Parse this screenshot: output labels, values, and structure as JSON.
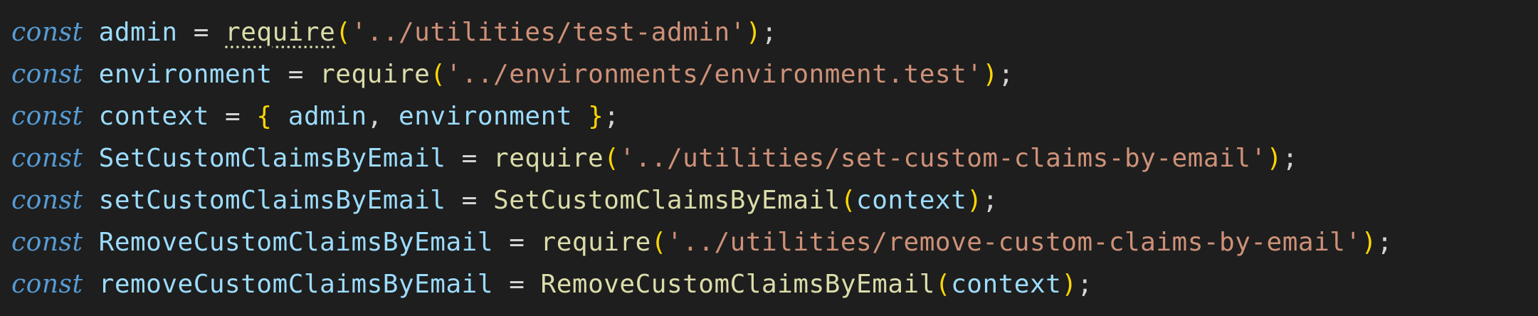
{
  "colors": {
    "background": "#1e1e1e",
    "keyword": "#569cd6",
    "identifier": "#9cdcfe",
    "operator": "#d4d4d4",
    "function": "#dcdcaa",
    "bracket": "#ffd700",
    "string": "#ce9178",
    "punctuation": "#d4d4d4"
  },
  "code": {
    "lines": [
      [
        {
          "text": "const",
          "kind": "keyword"
        },
        {
          "text": " ",
          "kind": "space"
        },
        {
          "text": "admin",
          "kind": "identifier"
        },
        {
          "text": " = ",
          "kind": "operator"
        },
        {
          "text": "require",
          "kind": "function",
          "decoration": "dotted"
        },
        {
          "text": "(",
          "kind": "bracket"
        },
        {
          "text": "'../utilities/test-admin'",
          "kind": "string"
        },
        {
          "text": ")",
          "kind": "bracket"
        },
        {
          "text": ";",
          "kind": "punctuation"
        }
      ],
      [
        {
          "text": "const",
          "kind": "keyword"
        },
        {
          "text": " ",
          "kind": "space"
        },
        {
          "text": "environment",
          "kind": "identifier"
        },
        {
          "text": " = ",
          "kind": "operator"
        },
        {
          "text": "require",
          "kind": "function"
        },
        {
          "text": "(",
          "kind": "bracket"
        },
        {
          "text": "'../environments/environment.test'",
          "kind": "string"
        },
        {
          "text": ")",
          "kind": "bracket"
        },
        {
          "text": ";",
          "kind": "punctuation"
        }
      ],
      [
        {
          "text": "const",
          "kind": "keyword"
        },
        {
          "text": " ",
          "kind": "space"
        },
        {
          "text": "context",
          "kind": "identifier"
        },
        {
          "text": " = ",
          "kind": "operator"
        },
        {
          "text": "{",
          "kind": "bracket"
        },
        {
          "text": " ",
          "kind": "space"
        },
        {
          "text": "admin",
          "kind": "identifier"
        },
        {
          "text": ", ",
          "kind": "punctuation"
        },
        {
          "text": "environment",
          "kind": "identifier"
        },
        {
          "text": " ",
          "kind": "space"
        },
        {
          "text": "}",
          "kind": "bracket"
        },
        {
          "text": ";",
          "kind": "punctuation"
        }
      ],
      [
        {
          "text": "const",
          "kind": "keyword"
        },
        {
          "text": " ",
          "kind": "space"
        },
        {
          "text": "SetCustomClaimsByEmail",
          "kind": "identifier"
        },
        {
          "text": " = ",
          "kind": "operator"
        },
        {
          "text": "require",
          "kind": "function"
        },
        {
          "text": "(",
          "kind": "bracket"
        },
        {
          "text": "'../utilities/set-custom-claims-by-email'",
          "kind": "string"
        },
        {
          "text": ")",
          "kind": "bracket"
        },
        {
          "text": ";",
          "kind": "punctuation"
        }
      ],
      [
        {
          "text": "const",
          "kind": "keyword"
        },
        {
          "text": " ",
          "kind": "space"
        },
        {
          "text": "setCustomClaimsByEmail",
          "kind": "identifier"
        },
        {
          "text": " = ",
          "kind": "operator"
        },
        {
          "text": "SetCustomClaimsByEmail",
          "kind": "function"
        },
        {
          "text": "(",
          "kind": "bracket"
        },
        {
          "text": "context",
          "kind": "identifier"
        },
        {
          "text": ")",
          "kind": "bracket"
        },
        {
          "text": ";",
          "kind": "punctuation"
        }
      ],
      [
        {
          "text": "const",
          "kind": "keyword"
        },
        {
          "text": " ",
          "kind": "space"
        },
        {
          "text": "RemoveCustomClaimsByEmail",
          "kind": "identifier"
        },
        {
          "text": " = ",
          "kind": "operator"
        },
        {
          "text": "require",
          "kind": "function"
        },
        {
          "text": "(",
          "kind": "bracket"
        },
        {
          "text": "'../utilities/remove-custom-claims-by-email'",
          "kind": "string"
        },
        {
          "text": ")",
          "kind": "bracket"
        },
        {
          "text": ";",
          "kind": "punctuation"
        }
      ],
      [
        {
          "text": "const",
          "kind": "keyword"
        },
        {
          "text": " ",
          "kind": "space"
        },
        {
          "text": "removeCustomClaimsByEmail",
          "kind": "identifier"
        },
        {
          "text": " = ",
          "kind": "operator"
        },
        {
          "text": "RemoveCustomClaimsByEmail",
          "kind": "function"
        },
        {
          "text": "(",
          "kind": "bracket"
        },
        {
          "text": "context",
          "kind": "identifier"
        },
        {
          "text": ")",
          "kind": "bracket"
        },
        {
          "text": ";",
          "kind": "punctuation"
        }
      ]
    ]
  }
}
